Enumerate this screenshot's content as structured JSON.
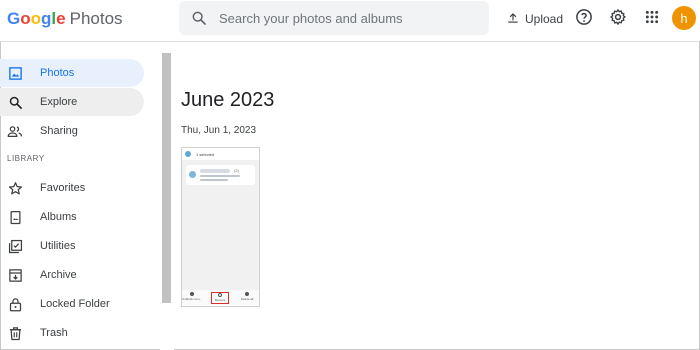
{
  "app": {
    "brand_google": "Google",
    "brand_product": "Photos"
  },
  "header": {
    "search_placeholder": "Search your photos and albums",
    "upload_label": "Upload",
    "avatar_initial": "h"
  },
  "sidebar": {
    "items": [
      {
        "label": "Photos",
        "icon": "photo-icon",
        "state": "active"
      },
      {
        "label": "Explore",
        "icon": "search-icon",
        "state": "hover"
      },
      {
        "label": "Sharing",
        "icon": "people-icon",
        "state": "normal"
      }
    ],
    "library_heading": "LIBRARY",
    "library_items": [
      {
        "label": "Favorites",
        "icon": "star-icon"
      },
      {
        "label": "Albums",
        "icon": "album-icon"
      },
      {
        "label": "Utilities",
        "icon": "utilities-icon"
      },
      {
        "label": "Archive",
        "icon": "archive-icon"
      },
      {
        "label": "Locked Folder",
        "icon": "lock-icon"
      },
      {
        "label": "Trash",
        "icon": "trash-icon"
      }
    ]
  },
  "main": {
    "month_title": "June 2023",
    "date_label": "Thu, Jun 1, 2023",
    "thumbnail": {
      "selected_text": "1 selected",
      "count_text": "(2)",
      "actions": [
        "Unblock num...",
        "Restore",
        "Delete all"
      ]
    }
  },
  "colors": {
    "accent": "#1a73e8",
    "active_bg": "#e8f0fe",
    "avatar_bg": "#f09300",
    "highlight_red": "#d93025"
  }
}
